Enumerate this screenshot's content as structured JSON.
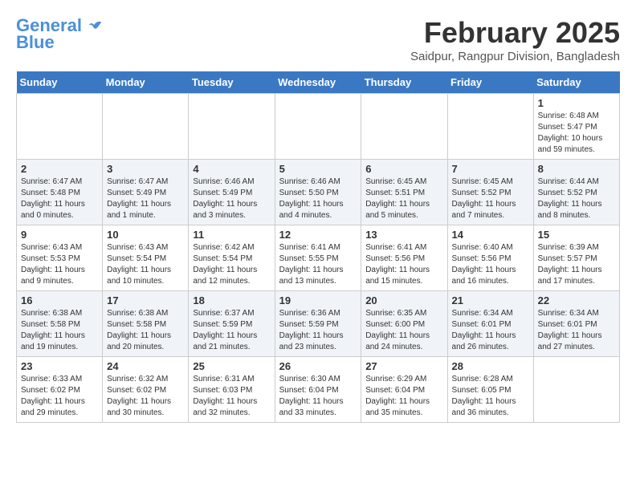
{
  "header": {
    "logo_line1": "General",
    "logo_line2": "Blue",
    "title": "February 2025",
    "subtitle": "Saidpur, Rangpur Division, Bangladesh"
  },
  "days_of_week": [
    "Sunday",
    "Monday",
    "Tuesday",
    "Wednesday",
    "Thursday",
    "Friday",
    "Saturday"
  ],
  "weeks": [
    [
      {
        "day": "",
        "info": ""
      },
      {
        "day": "",
        "info": ""
      },
      {
        "day": "",
        "info": ""
      },
      {
        "day": "",
        "info": ""
      },
      {
        "day": "",
        "info": ""
      },
      {
        "day": "",
        "info": ""
      },
      {
        "day": "1",
        "info": "Sunrise: 6:48 AM\nSunset: 5:47 PM\nDaylight: 10 hours and 59 minutes."
      }
    ],
    [
      {
        "day": "2",
        "info": "Sunrise: 6:47 AM\nSunset: 5:48 PM\nDaylight: 11 hours and 0 minutes."
      },
      {
        "day": "3",
        "info": "Sunrise: 6:47 AM\nSunset: 5:49 PM\nDaylight: 11 hours and 1 minute."
      },
      {
        "day": "4",
        "info": "Sunrise: 6:46 AM\nSunset: 5:49 PM\nDaylight: 11 hours and 3 minutes."
      },
      {
        "day": "5",
        "info": "Sunrise: 6:46 AM\nSunset: 5:50 PM\nDaylight: 11 hours and 4 minutes."
      },
      {
        "day": "6",
        "info": "Sunrise: 6:45 AM\nSunset: 5:51 PM\nDaylight: 11 hours and 5 minutes."
      },
      {
        "day": "7",
        "info": "Sunrise: 6:45 AM\nSunset: 5:52 PM\nDaylight: 11 hours and 7 minutes."
      },
      {
        "day": "8",
        "info": "Sunrise: 6:44 AM\nSunset: 5:52 PM\nDaylight: 11 hours and 8 minutes."
      }
    ],
    [
      {
        "day": "9",
        "info": "Sunrise: 6:43 AM\nSunset: 5:53 PM\nDaylight: 11 hours and 9 minutes."
      },
      {
        "day": "10",
        "info": "Sunrise: 6:43 AM\nSunset: 5:54 PM\nDaylight: 11 hours and 10 minutes."
      },
      {
        "day": "11",
        "info": "Sunrise: 6:42 AM\nSunset: 5:54 PM\nDaylight: 11 hours and 12 minutes."
      },
      {
        "day": "12",
        "info": "Sunrise: 6:41 AM\nSunset: 5:55 PM\nDaylight: 11 hours and 13 minutes."
      },
      {
        "day": "13",
        "info": "Sunrise: 6:41 AM\nSunset: 5:56 PM\nDaylight: 11 hours and 15 minutes."
      },
      {
        "day": "14",
        "info": "Sunrise: 6:40 AM\nSunset: 5:56 PM\nDaylight: 11 hours and 16 minutes."
      },
      {
        "day": "15",
        "info": "Sunrise: 6:39 AM\nSunset: 5:57 PM\nDaylight: 11 hours and 17 minutes."
      }
    ],
    [
      {
        "day": "16",
        "info": "Sunrise: 6:38 AM\nSunset: 5:58 PM\nDaylight: 11 hours and 19 minutes."
      },
      {
        "day": "17",
        "info": "Sunrise: 6:38 AM\nSunset: 5:58 PM\nDaylight: 11 hours and 20 minutes."
      },
      {
        "day": "18",
        "info": "Sunrise: 6:37 AM\nSunset: 5:59 PM\nDaylight: 11 hours and 21 minutes."
      },
      {
        "day": "19",
        "info": "Sunrise: 6:36 AM\nSunset: 5:59 PM\nDaylight: 11 hours and 23 minutes."
      },
      {
        "day": "20",
        "info": "Sunrise: 6:35 AM\nSunset: 6:00 PM\nDaylight: 11 hours and 24 minutes."
      },
      {
        "day": "21",
        "info": "Sunrise: 6:34 AM\nSunset: 6:01 PM\nDaylight: 11 hours and 26 minutes."
      },
      {
        "day": "22",
        "info": "Sunrise: 6:34 AM\nSunset: 6:01 PM\nDaylight: 11 hours and 27 minutes."
      }
    ],
    [
      {
        "day": "23",
        "info": "Sunrise: 6:33 AM\nSunset: 6:02 PM\nDaylight: 11 hours and 29 minutes."
      },
      {
        "day": "24",
        "info": "Sunrise: 6:32 AM\nSunset: 6:02 PM\nDaylight: 11 hours and 30 minutes."
      },
      {
        "day": "25",
        "info": "Sunrise: 6:31 AM\nSunset: 6:03 PM\nDaylight: 11 hours and 32 minutes."
      },
      {
        "day": "26",
        "info": "Sunrise: 6:30 AM\nSunset: 6:04 PM\nDaylight: 11 hours and 33 minutes."
      },
      {
        "day": "27",
        "info": "Sunrise: 6:29 AM\nSunset: 6:04 PM\nDaylight: 11 hours and 35 minutes."
      },
      {
        "day": "28",
        "info": "Sunrise: 6:28 AM\nSunset: 6:05 PM\nDaylight: 11 hours and 36 minutes."
      },
      {
        "day": "",
        "info": ""
      }
    ]
  ]
}
